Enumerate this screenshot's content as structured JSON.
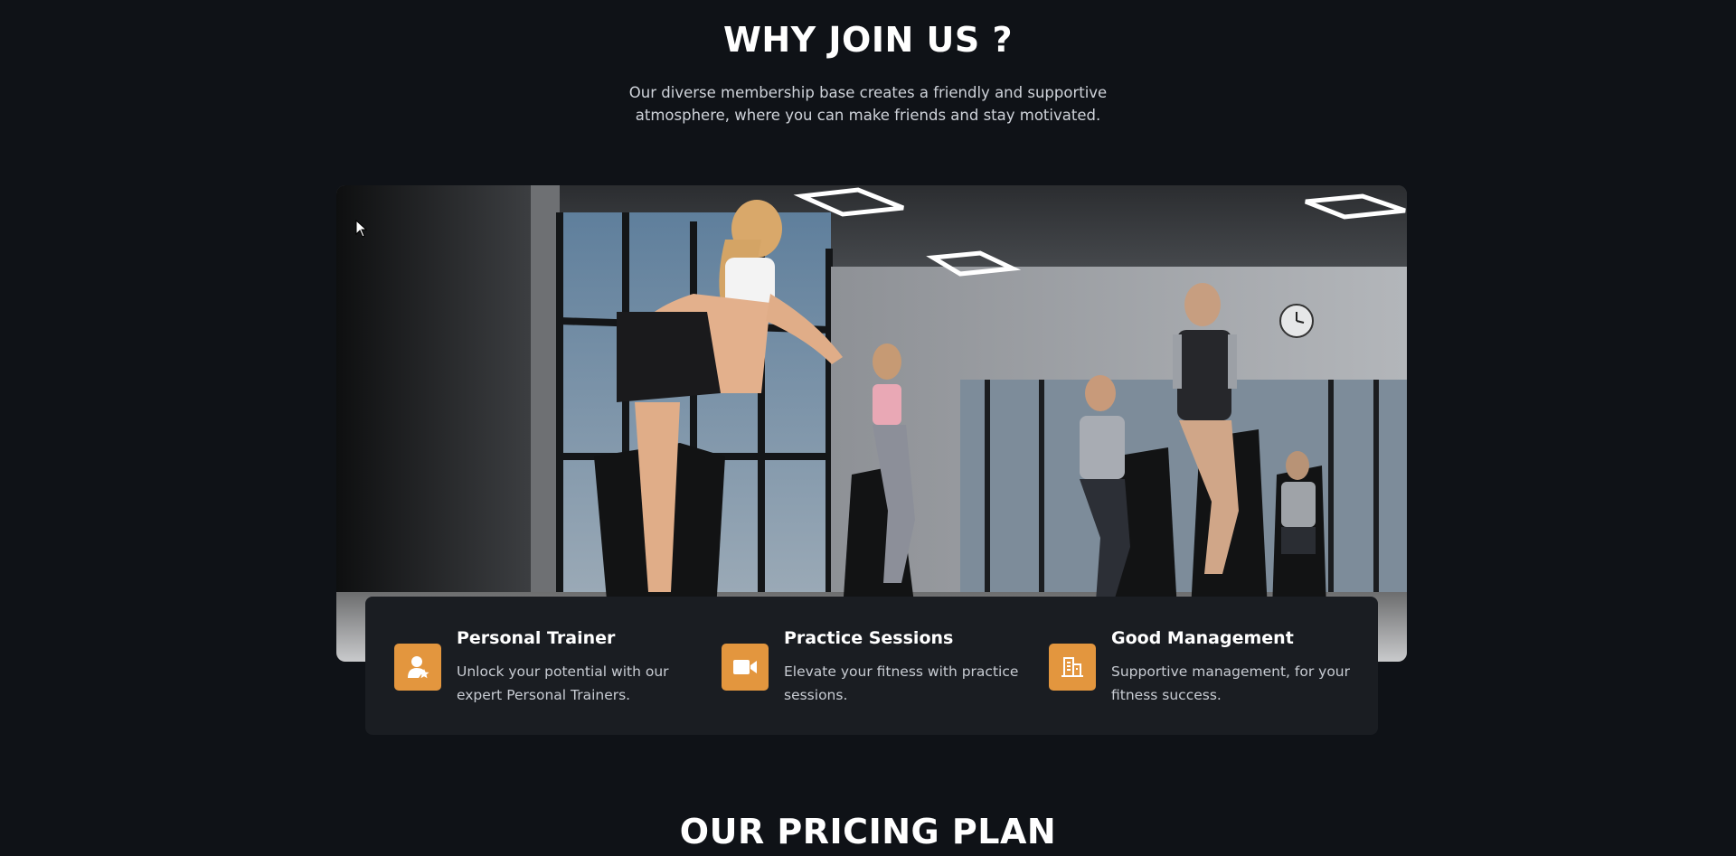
{
  "why_section": {
    "title": "WHY JOIN US ?",
    "intro_line1": "Our diverse membership base creates a friendly and supportive",
    "intro_line2": "atmosphere, where you can make friends and stay motivated."
  },
  "hero_image": {
    "alt": "Group indoor cycling class in a gym"
  },
  "features": [
    {
      "title": "Personal Trainer",
      "description": "Unlock your potential with our expert Personal Trainers.",
      "icon": "trainer-icon"
    },
    {
      "title": "Practice Sessions",
      "description": "Elevate your fitness with practice sessions.",
      "icon": "video-camera-icon"
    },
    {
      "title": "Good Management",
      "description": "Supportive management, for your fitness success.",
      "icon": "building-icon"
    }
  ],
  "pricing_section": {
    "title": "OUR PRICING PLAN"
  },
  "colors": {
    "background": "#0f1217",
    "card": "#1a1d22",
    "accent": "#e3963e"
  }
}
